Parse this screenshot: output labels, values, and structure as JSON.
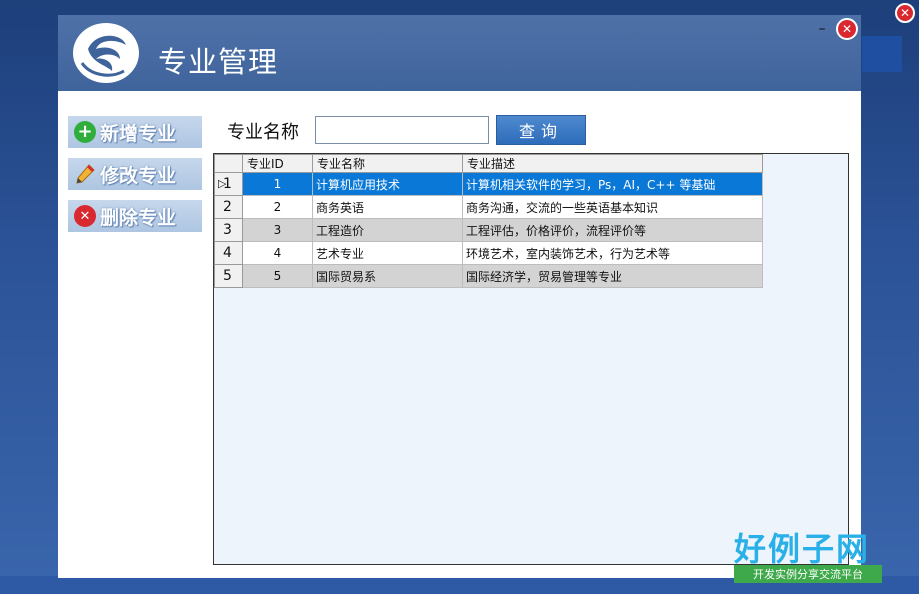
{
  "window": {
    "title": "专业管理",
    "minimize_symbol": "–",
    "close_symbol": "✕"
  },
  "sidebar": {
    "items": [
      {
        "label": "新增专业",
        "icon": "add-icon"
      },
      {
        "label": "修改专业",
        "icon": "pencil-icon"
      },
      {
        "label": "删除专业",
        "icon": "delete-icon"
      }
    ]
  },
  "search": {
    "label": "专业名称",
    "value": "",
    "button_label": "查询"
  },
  "table": {
    "columns": [
      "专业ID",
      "专业名称",
      "专业描述"
    ],
    "rows": [
      {
        "row_no": "1",
        "id": "1",
        "name": "计算机应用技术",
        "desc": "计算机相关软件的学习，Ps，AI，C++ 等基础",
        "selected": true
      },
      {
        "row_no": "2",
        "id": "2",
        "name": "商务英语",
        "desc": "商务沟通，交流的一些英语基本知识"
      },
      {
        "row_no": "3",
        "id": "3",
        "name": "工程造价",
        "desc": "工程评估，价格评价，流程评价等"
      },
      {
        "row_no": "4",
        "id": "4",
        "name": "艺术专业",
        "desc": "环境艺术，室内装饰艺术，行为艺术等"
      },
      {
        "row_no": "5",
        "id": "5",
        "name": "国际贸易系",
        "desc": "国际经济学，贸易管理等专业"
      }
    ]
  },
  "watermark": {
    "logo_text": "好例子网",
    "tagline": "开发实例分享交流平台"
  },
  "colors": {
    "titlebar": "#4e72a8",
    "selected_row": "#0a78d7",
    "query_button": "#2d6cba",
    "close_button": "#d9282f"
  }
}
